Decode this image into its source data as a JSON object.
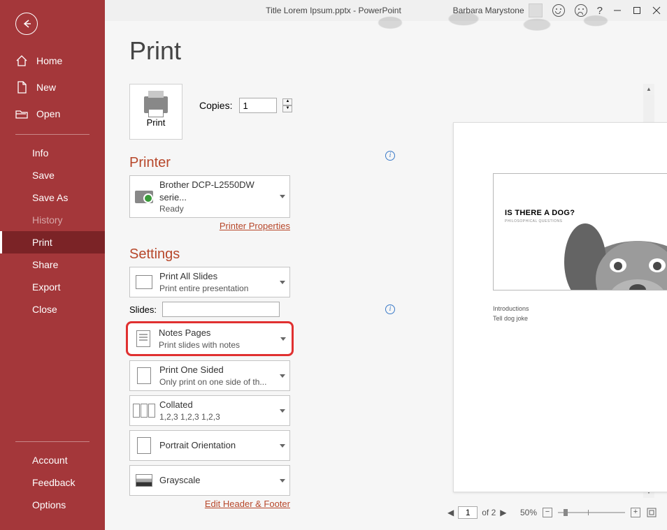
{
  "titlebar": {
    "title": "Title Lorem Ipsum.pptx  -  PowerPoint",
    "user": "Barbara Marystone",
    "help": "?"
  },
  "sidebar": {
    "home": "Home",
    "new": "New",
    "open": "Open",
    "info": "Info",
    "save": "Save",
    "saveas": "Save As",
    "history": "History",
    "print": "Print",
    "share": "Share",
    "export": "Export",
    "close": "Close",
    "account": "Account",
    "feedback": "Feedback",
    "options": "Options"
  },
  "main": {
    "heading": "Print",
    "print_btn": "Print",
    "copies_label": "Copies:",
    "copies_value": "1",
    "printer_heading": "Printer",
    "printer": {
      "name": "Brother DCP-L2550DW serie...",
      "status": "Ready"
    },
    "printer_props": "Printer Properties",
    "settings_heading": "Settings",
    "slides_label": "Slides:",
    "settings": [
      {
        "title": "Print All Slides",
        "sub": "Print entire presentation"
      },
      {
        "title": "Notes Pages",
        "sub": "Print slides with notes"
      },
      {
        "title": "Print One Sided",
        "sub": "Only print on one side of th..."
      },
      {
        "title": "Collated",
        "sub": "1,2,3    1,2,3    1,2,3"
      },
      {
        "title": "Portrait Orientation",
        "sub": ""
      },
      {
        "title": "Grayscale",
        "sub": ""
      }
    ],
    "edit_hf": "Edit Header & Footer"
  },
  "preview": {
    "slide_title": "IS THERE A DOG?",
    "slide_sub": "PHILOSOPHICAL QUESTIONS",
    "notes": [
      "Introductions",
      "Tell dog joke"
    ],
    "page_number": "1"
  },
  "status": {
    "page": "1",
    "of": "of 2",
    "zoom": "50%"
  }
}
